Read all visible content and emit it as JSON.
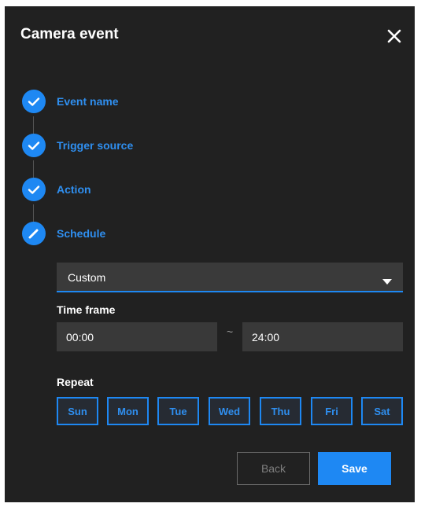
{
  "dialog": {
    "title": "Camera event",
    "close_icon": "close-icon"
  },
  "steps": [
    {
      "label": "Event name",
      "state": "completed",
      "icon": "check-icon"
    },
    {
      "label": "Trigger source",
      "state": "completed",
      "icon": "check-icon"
    },
    {
      "label": "Action",
      "state": "completed",
      "icon": "check-icon"
    },
    {
      "label": "Schedule",
      "state": "active",
      "icon": "pencil-icon"
    }
  ],
  "schedule": {
    "selected": "Custom",
    "time_frame_label": "Time frame",
    "start_time": "00:00",
    "separator": "~",
    "end_time": "24:00",
    "repeat_label": "Repeat",
    "days": [
      "Sun",
      "Mon",
      "Tue",
      "Wed",
      "Thu",
      "Fri",
      "Sat"
    ]
  },
  "buttons": {
    "back": "Back",
    "save": "Save"
  },
  "colors": {
    "background": "#212121",
    "accent": "#1e88f3",
    "field": "#393939"
  }
}
